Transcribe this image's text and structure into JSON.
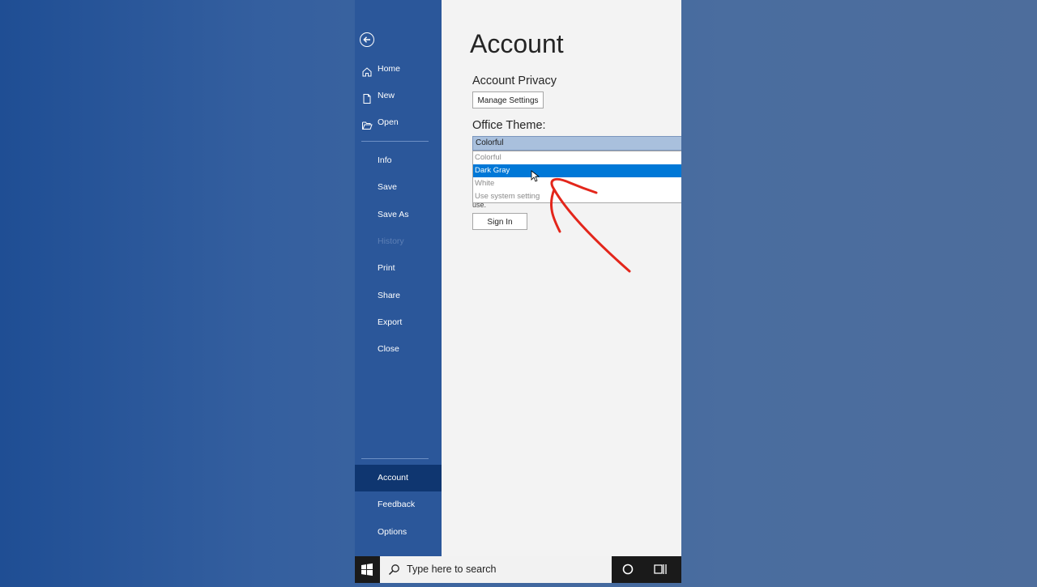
{
  "colors": {
    "sidebar": "#2b579a",
    "sidebar_active": "#0f3670",
    "main_bg": "#f3f3f3",
    "highlight": "#0078d7",
    "annotation": "#e3261b"
  },
  "sidebar": {
    "items": [
      {
        "label": "Home",
        "icon": "home-icon"
      },
      {
        "label": "New",
        "icon": "new-document-icon"
      },
      {
        "label": "Open",
        "icon": "folder-open-icon"
      },
      {
        "label": "Info"
      },
      {
        "label": "Save"
      },
      {
        "label": "Save As"
      },
      {
        "label": "History",
        "disabled": true
      },
      {
        "label": "Print"
      },
      {
        "label": "Share"
      },
      {
        "label": "Export"
      },
      {
        "label": "Close"
      },
      {
        "label": "Account",
        "active": true
      },
      {
        "label": "Feedback"
      },
      {
        "label": "Options"
      }
    ]
  },
  "main": {
    "title": "Account",
    "privacy": {
      "heading": "Account Privacy",
      "button": "Manage Settings"
    },
    "theme": {
      "heading": "Office Theme:",
      "selected": "Colorful",
      "options": [
        "Colorful",
        "Dark Gray",
        "White",
        "Use system setting"
      ],
      "highlighted": "Dark Gray"
    },
    "partial_text": "use.",
    "signin_button": "Sign In"
  },
  "taskbar": {
    "search_placeholder": "Type here to search"
  }
}
